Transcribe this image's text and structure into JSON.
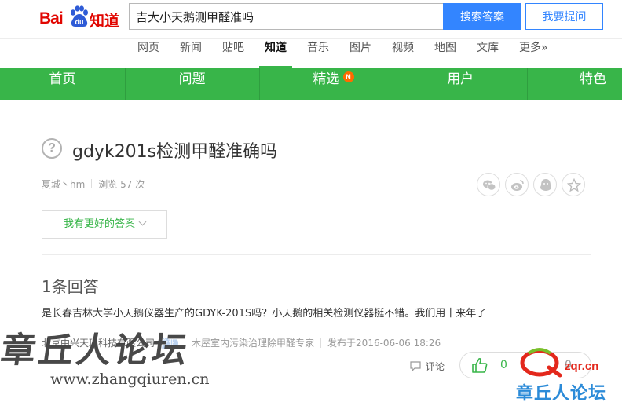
{
  "header": {
    "logo_bai": "Bai",
    "logo_du": "du",
    "logo_zhidao": "知道",
    "search_value": "吉大小天鹅测甲醛准吗",
    "search_button": "搜索答案",
    "ask_button": "我要提问"
  },
  "nav": {
    "items": [
      "网页",
      "新闻",
      "贴吧",
      "知道",
      "音乐",
      "图片",
      "视频",
      "地图",
      "文库",
      "更多»"
    ],
    "active": "知道"
  },
  "greenbar": {
    "items": [
      "首页",
      "问题",
      "精选",
      "用户",
      "特色"
    ],
    "badge": "N"
  },
  "question": {
    "title": "gdyk201s检测甲醛准确吗",
    "author": "夏城丶hm",
    "views": "浏览 57 次"
  },
  "share_icons": [
    "wechat-icon",
    "weibo-icon",
    "qq-icon",
    "favorite-star-icon"
  ],
  "better_answer_button": "我有更好的答案",
  "answers": {
    "count_label": "1条回答",
    "items": [
      {
        "text": "是长春吉林大学小天鹅仪器生产的GDYK-201S吗？小天鹅的相关检测仪器挺不错。我们用十来年了",
        "company": "北京中兴天瑞科技有限公司",
        "badge": "企业",
        "role": "木屋室内污染治理除甲醛专家",
        "published": "发布于2016-06-06 18:26",
        "comment_label": "评论",
        "likes": "0",
        "dislikes": "0"
      }
    ]
  },
  "watermarks": {
    "left_callig": "章丘人论坛",
    "left_url": "www.zhangqiuren.cn",
    "right_domain": "zqr.cn",
    "right_cn": "章丘人论坛"
  },
  "colors": {
    "green": "#38b549",
    "blue": "#3385ff",
    "baidu_red": "#e10601"
  }
}
